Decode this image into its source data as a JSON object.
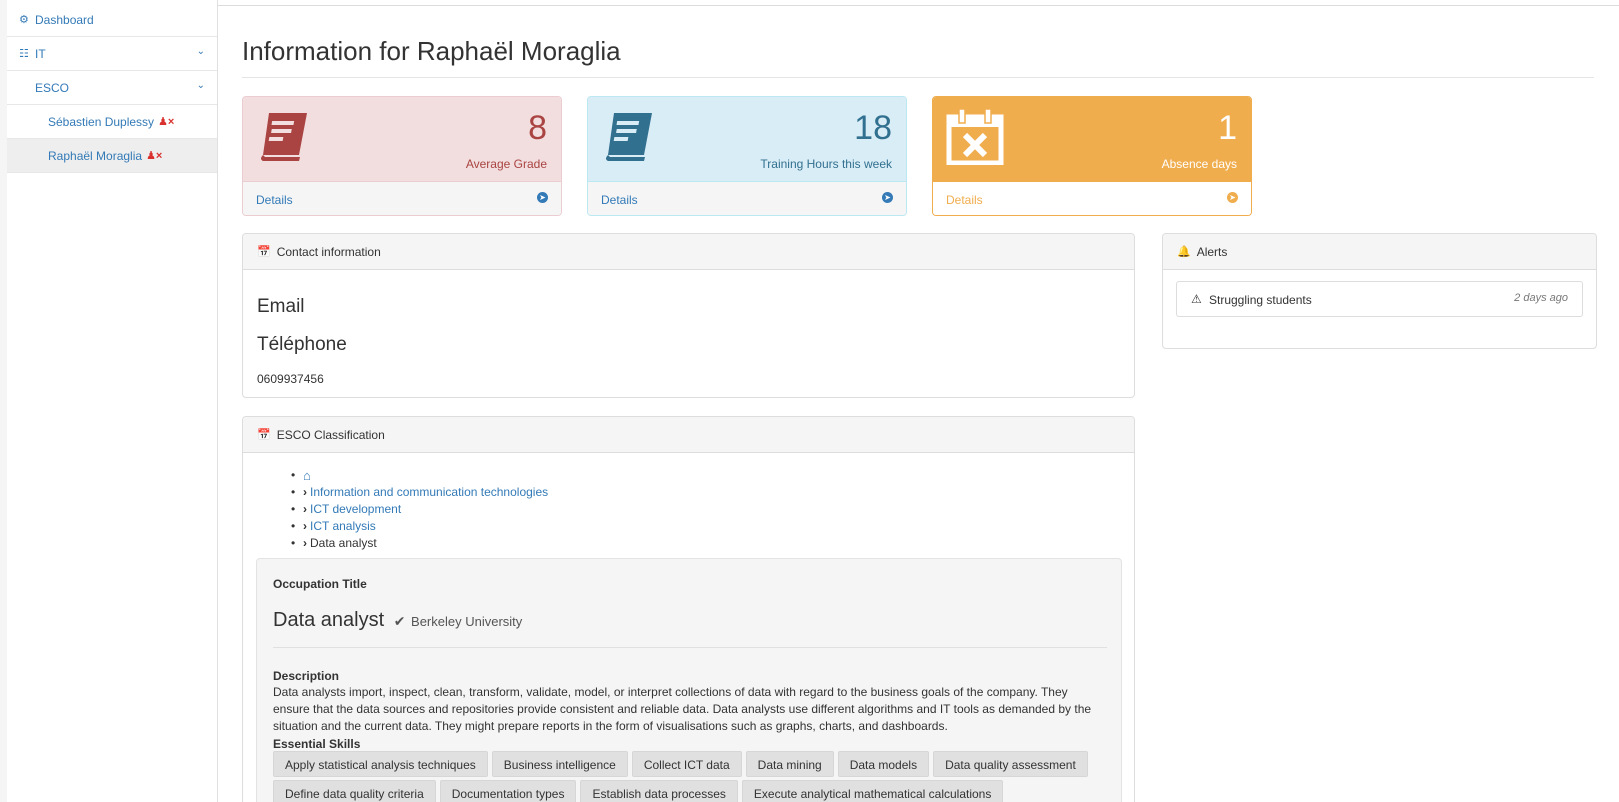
{
  "sidebar": {
    "items": [
      {
        "label": "Dashboard",
        "icon": "dashboard-icon"
      },
      {
        "label": "IT",
        "icon": "sitemap-icon"
      },
      {
        "label": "ESCO"
      },
      {
        "label": "Sébastien Duplessy",
        "icon": "remove-user-icon"
      },
      {
        "label": "Raphaël Moraglia",
        "icon": "remove-user-icon",
        "active": true
      }
    ]
  },
  "page": {
    "title": "Information for Raphaël Moraglia"
  },
  "stats": [
    {
      "value": "8",
      "caption": "Average Grade",
      "details": "Details",
      "icon": "book-icon",
      "color": "#a94442"
    },
    {
      "value": "18",
      "caption": "Training Hours this week",
      "details": "Details",
      "icon": "book-icon",
      "color": "#31708f"
    },
    {
      "value": "1",
      "caption": "Absence days",
      "details": "Details",
      "icon": "calendar-times-icon",
      "color": "#f0ad4e"
    }
  ],
  "contact": {
    "heading": "Contact information",
    "email_label": "Email",
    "phone_label": "Téléphone",
    "phone_value": "0609937456"
  },
  "alerts": {
    "heading": "Alerts",
    "items": [
      {
        "text": "Struggling students",
        "time": "2 days ago",
        "icon": "warning-icon"
      }
    ]
  },
  "esco": {
    "heading": "ESCO Classification",
    "breadcrumb": [
      {
        "label": "",
        "icon": "home-icon"
      },
      {
        "label": "Information and communication technologies",
        "link": true
      },
      {
        "label": "ICT development",
        "link": true
      },
      {
        "label": "ICT analysis",
        "link": true
      },
      {
        "label": "Data analyst",
        "link": false
      }
    ],
    "occupation_title_label": "Occupation Title",
    "occupation_title": "Data analyst",
    "occupation_source": "Berkeley University",
    "description_label": "Description",
    "description": "Data analysts import, inspect, clean, transform, validate, model, or interpret collections of data with regard to the business goals of the company. They ensure that the data sources and repositories provide consistent and reliable data. Data analysts use different algorithms and IT tools as demanded by the situation and the current data. They might prepare reports in the form of visualisations such as graphs, charts, and dashboards.",
    "skills_label": "Essential Skills",
    "skills": [
      "Apply statistical analysis techniques",
      "Business intelligence",
      "Collect ICT data",
      "Data mining",
      "Data models",
      "Data quality assessment",
      "Define data quality criteria",
      "Documentation types",
      "Establish data processes",
      "Execute analytical mathematical calculations"
    ]
  }
}
